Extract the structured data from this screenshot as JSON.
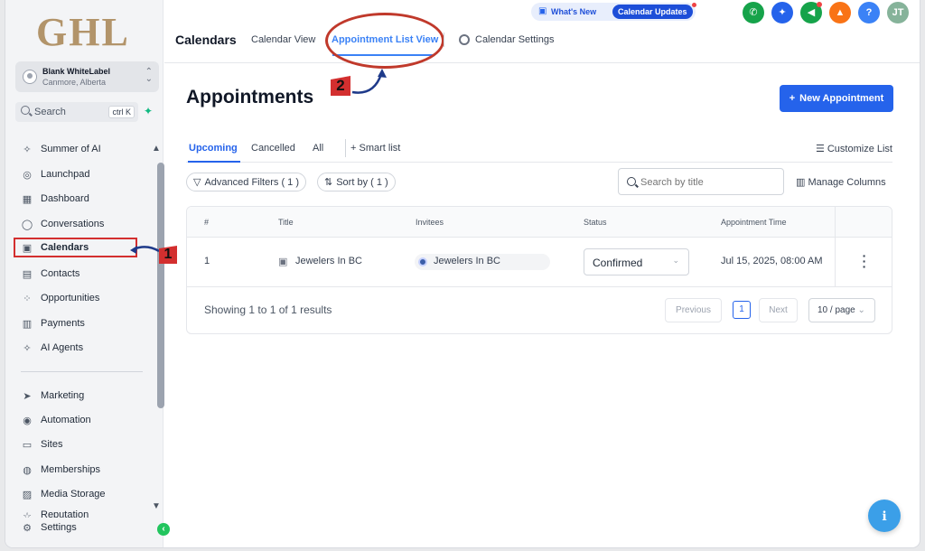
{
  "sidebar": {
    "logo": "GHL",
    "account_name": "Blank WhiteLabel",
    "account_location": "Canmore, Alberta",
    "search_label": "Search",
    "search_shortcut": "ctrl K",
    "items": [
      {
        "label": "Summer of AI",
        "icon": "sparkle-icon"
      },
      {
        "label": "Launchpad",
        "icon": "rocket-icon"
      },
      {
        "label": "Dashboard",
        "icon": "dashboard-icon"
      },
      {
        "label": "Conversations",
        "icon": "chat-icon"
      },
      {
        "label": "Calendars",
        "icon": "calendar-icon"
      },
      {
        "label": "Contacts",
        "icon": "contacts-icon"
      },
      {
        "label": "Opportunities",
        "icon": "opportunities-icon"
      },
      {
        "label": "Payments",
        "icon": "payments-icon"
      },
      {
        "label": "AI Agents",
        "icon": "ai-agents-icon"
      },
      {
        "label": "Marketing",
        "icon": "send-icon"
      },
      {
        "label": "Automation",
        "icon": "automation-icon"
      },
      {
        "label": "Sites",
        "icon": "sites-icon"
      },
      {
        "label": "Memberships",
        "icon": "memberships-icon"
      },
      {
        "label": "Media Storage",
        "icon": "media-icon"
      },
      {
        "label": "Reputation",
        "icon": "star-icon"
      },
      {
        "label": "Settings",
        "icon": "gear-icon"
      }
    ]
  },
  "annotations": {
    "one": "1",
    "two": "2"
  },
  "topbar": {
    "title": "Calendars",
    "tabs": [
      "Calendar View",
      "Appointment List View",
      "Calendar Settings"
    ],
    "whats_new": "What's New",
    "updates_pill": "Calendar Updates",
    "user_initials": "JT",
    "help_label": "?"
  },
  "page": {
    "heading": "Appointments",
    "new_button": "New Appointment",
    "subtabs": [
      "Upcoming",
      "Cancelled",
      "All"
    ],
    "smart_list": "+ Smart list",
    "customize_list": "Customize List",
    "advanced_filters": "Advanced Filters ( 1 )",
    "sort_by": "Sort by ( 1 )",
    "search_placeholder": "Search by title",
    "manage_columns": "Manage Columns"
  },
  "table": {
    "headers": [
      "#",
      "Title",
      "Invitees",
      "Status",
      "Appointment Time"
    ],
    "rows": [
      {
        "num": "1",
        "title": "Jewelers In BC",
        "invitee": "Jewelers In BC",
        "status": "Confirmed",
        "time": "Jul 15, 2025, 08:00 AM"
      }
    ],
    "showing": "Showing 1 to 1 of 1 results",
    "previous": "Previous",
    "page": "1",
    "next": "Next",
    "per_page": "10 / page"
  },
  "colors": {
    "accent": "#2563eb",
    "annotation": "#d32f2f",
    "logo": "#b2946a"
  }
}
